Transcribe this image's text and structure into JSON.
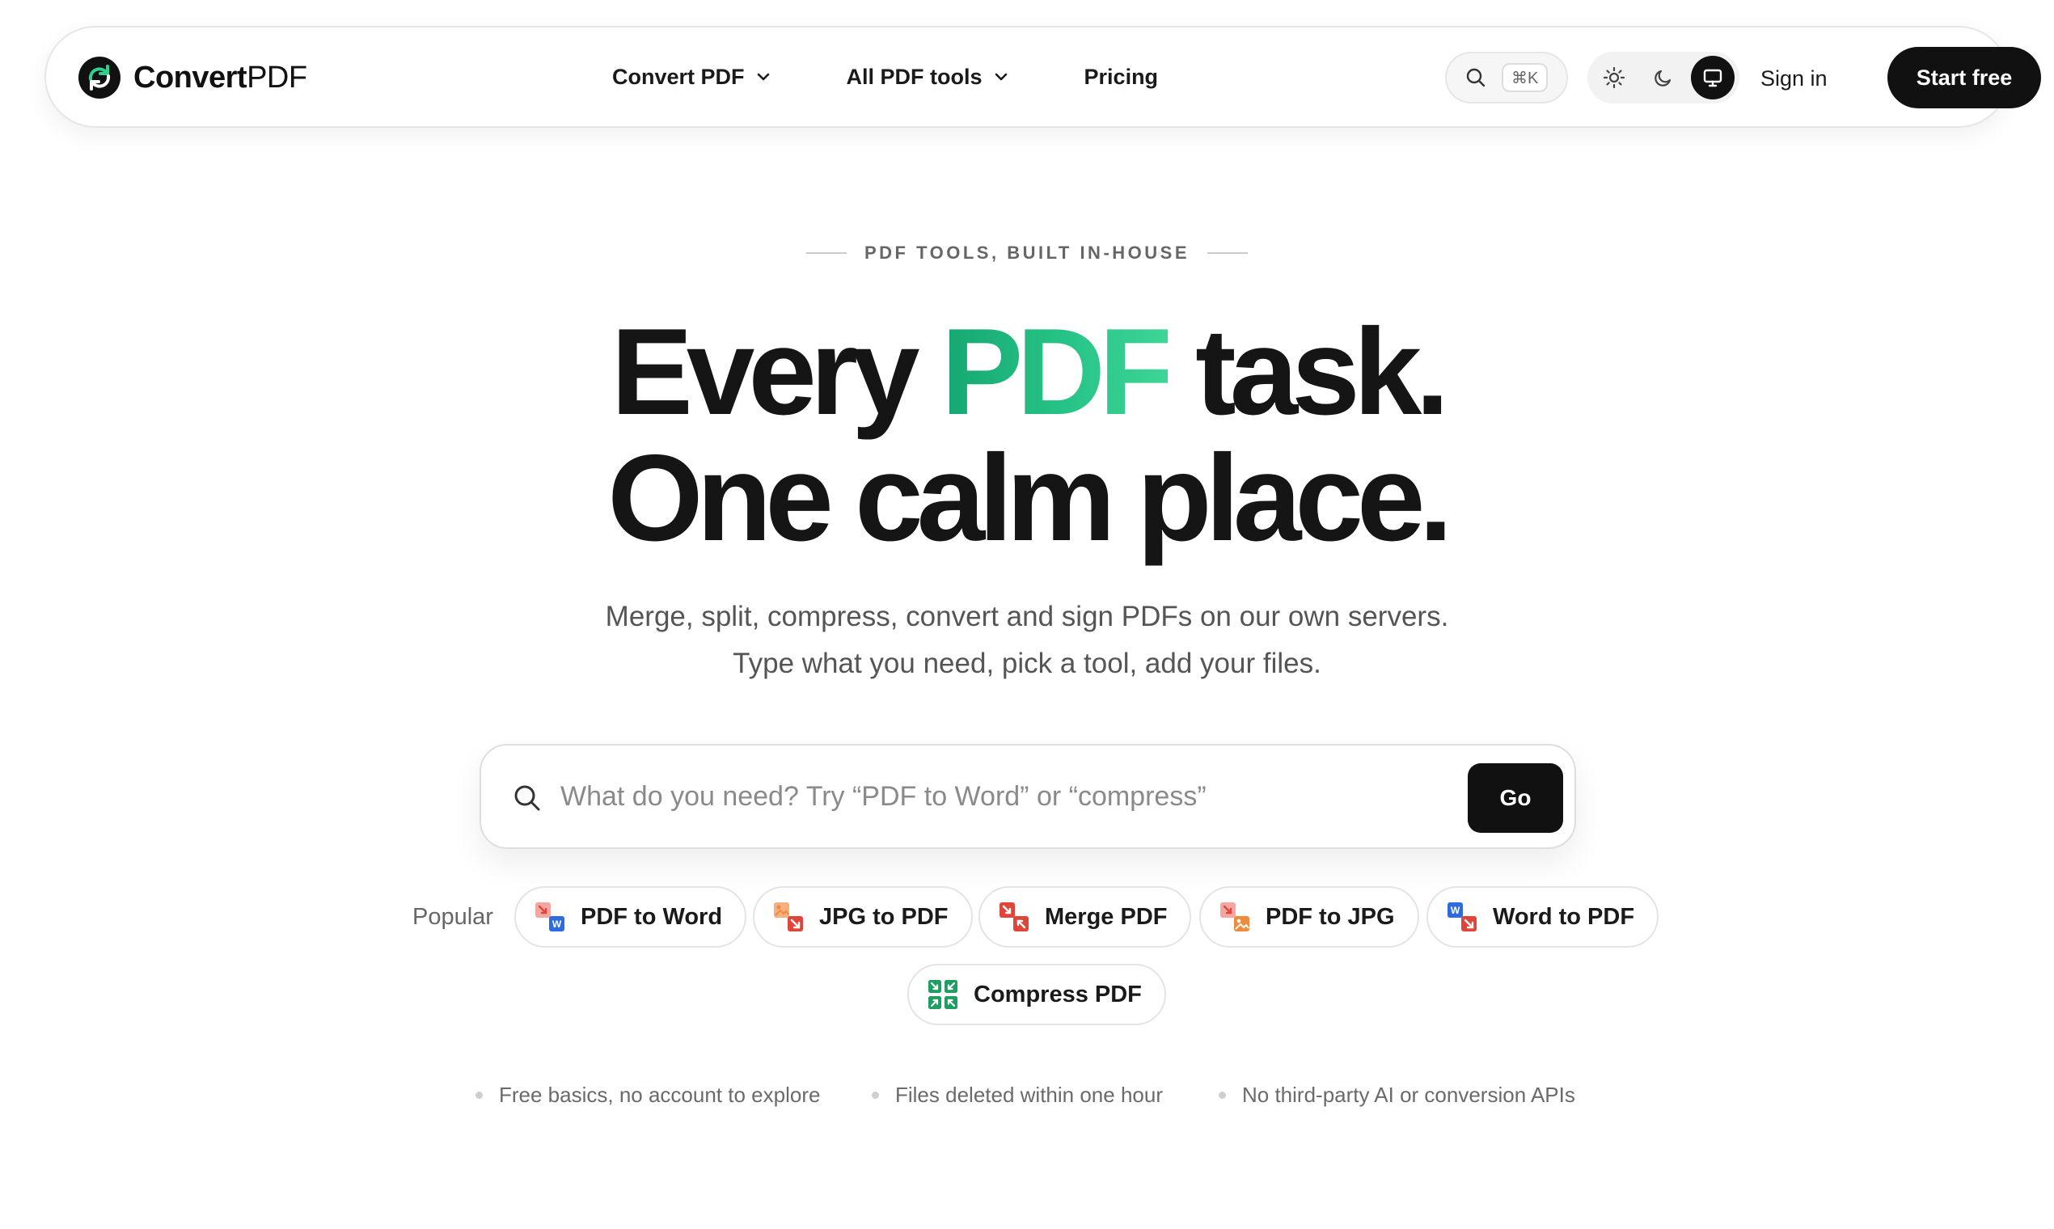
{
  "brand": {
    "name_bold": "Convert",
    "name_light": "PDF",
    "accent": "#1aa874"
  },
  "nav": {
    "links": [
      {
        "label": "Convert PDF",
        "has_dropdown": true
      },
      {
        "label": "All PDF tools",
        "has_dropdown": true
      },
      {
        "label": "Pricing",
        "has_dropdown": false
      }
    ],
    "search_shortcut": "⌘K",
    "theme_options": [
      "light",
      "dark",
      "system"
    ],
    "theme_selected": "system",
    "signin_label": "Sign in",
    "start_label": "Start free"
  },
  "hero": {
    "eyebrow": "PDF TOOLS, BUILT IN-HOUSE",
    "headline_line1_pre": "Every ",
    "headline_line1_accent": "PDF",
    "headline_line1_post": " task.",
    "headline_line2": "One calm place.",
    "subtext_line1": "Merge, split, compress, convert and sign PDFs on our own servers.",
    "subtext_line2": "Type what you need, pick a tool, add your files."
  },
  "search": {
    "placeholder": "What do you need? Try “PDF to Word” or “compress”",
    "value": "",
    "go_label": "Go"
  },
  "popular": {
    "label": "Popular",
    "chips": [
      {
        "label": "PDF to Word",
        "icon": "pdf-to-word-icon"
      },
      {
        "label": "JPG to PDF",
        "icon": "jpg-to-pdf-icon"
      },
      {
        "label": "Merge PDF",
        "icon": "merge-pdf-icon"
      },
      {
        "label": "PDF to JPG",
        "icon": "pdf-to-jpg-icon"
      },
      {
        "label": "Word to PDF",
        "icon": "word-to-pdf-icon"
      },
      {
        "label": "Compress PDF",
        "icon": "compress-pdf-icon"
      }
    ]
  },
  "features": [
    "Free basics, no account to explore",
    "Files deleted within one hour",
    "No third-party AI or conversion APIs"
  ],
  "colors": {
    "pdf_red": "#e0453a",
    "word_blue": "#2f6be0",
    "image_orange": "#f08a3c",
    "compress_green": "#1f9e62"
  }
}
